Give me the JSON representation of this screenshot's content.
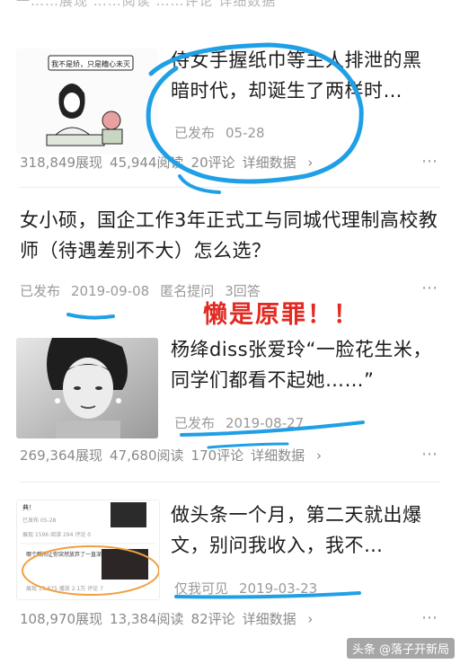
{
  "top_fragment": "一……展现 ……阅读 ……评论 详细数据",
  "annotation_text": "懒是原罪！！",
  "watermark": "头条 @落子开新局",
  "more_icon": "⋯",
  "chevron": "›",
  "articles": [
    {
      "title": "侍女手握纸巾等主人排泄的黑暗时代，却诞生了两样时…",
      "status": "已发布",
      "date": "05-28",
      "thumb_caption": "我不是矫，只是糟心未灭",
      "views": "318,849展现",
      "reads": "45,944阅读",
      "comments": "20评论",
      "detail": "详细数据"
    },
    {
      "title": "女小硕，国企工作3年正式工与同城代理制高校教师（待遇差别不大）怎么选？",
      "status": "已发布",
      "date": "2019-09-08",
      "extra1": "匿名提问",
      "extra2": "3回答"
    },
    {
      "title": "杨绛diss张爱玲“一脸花生米，同学们都看不起她……”",
      "status": "已发布",
      "date": "2019-08-27",
      "views": "269,364展现",
      "reads": "47,680阅读",
      "comments": "170评论",
      "detail": "详细数据"
    },
    {
      "title": "做头条一个月，第二天就出爆文，别问我收入，我不…",
      "status": "仅我可见",
      "date": "2019-03-23",
      "thumb_lines": [
        "典！",
        "已发布 05-28",
        "展现 1596  阅读 294  评论 0",
        "哪个瞬间让你突然放弃了一直深爱的人？",
        "展现 13,875  播放 2.1万  评论 7"
      ],
      "views": "108,970展现",
      "reads": "13,384阅读",
      "comments": "82评论",
      "detail": "详细数据"
    }
  ],
  "colors": {
    "annotation_red": "#e22a23",
    "marker_blue": "#1fa0e6",
    "muted": "#9a9a9a",
    "thumb_orange": "#f0a040"
  }
}
